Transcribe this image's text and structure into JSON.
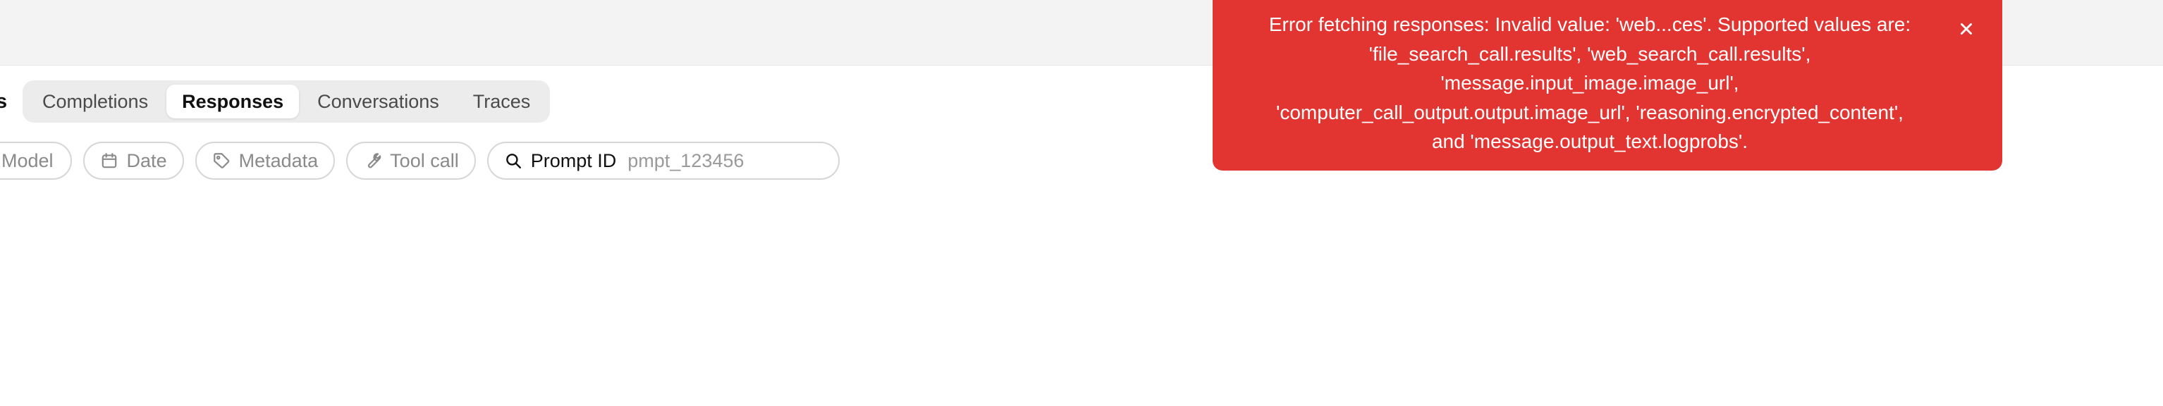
{
  "header": {
    "cut_label": "s"
  },
  "tabs": [
    {
      "label": "Completions",
      "active": false
    },
    {
      "label": "Responses",
      "active": true
    },
    {
      "label": "Conversations",
      "active": false
    },
    {
      "label": "Traces",
      "active": false
    }
  ],
  "filters": {
    "model_label": "Model",
    "date_label": "Date",
    "metadata_label": "Metadata",
    "tool_call_label": "Tool call",
    "prompt_id_label": "Prompt ID",
    "prompt_id_placeholder": "pmpt_123456",
    "prompt_id_value": ""
  },
  "toast": {
    "message": "Error fetching responses: Invalid value: 'web...ces'. Supported values are: 'file_search_call.results', 'web_search_call.results', 'message.input_image.image_url', 'computer_call_output.output.image_url', 'reasoning.encrypted_content', and 'message.output_text.logprobs'.",
    "lines": [
      "Error fetching responses: Invalid value: 'web...ces'. Supported values are:",
      "'file_search_call.results', 'web_search_call.results',",
      "'message.input_image.image_url',",
      "'computer_call_output.output.image_url', 'reasoning.encrypted_content',",
      "and 'message.output_text.logprobs'."
    ],
    "background": "#e23431",
    "close_icon": "close-icon"
  },
  "colors": {
    "top_strip": "#f3f3f3",
    "tab_group_bg": "#ececec",
    "chip_border": "#d6d6d6",
    "error": "#e23431"
  }
}
